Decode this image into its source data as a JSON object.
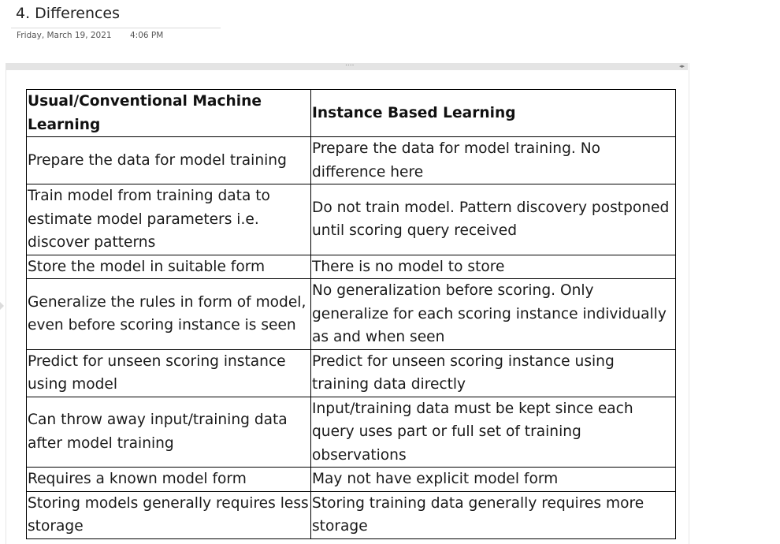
{
  "note": {
    "title": "4. Differences",
    "date": "Friday, March 19, 2021",
    "time": "4:06 PM"
  },
  "image_frame": {
    "grip": "....",
    "arrows": "◂▸"
  },
  "table": {
    "headers": [
      "Usual/Conventional Machine Learning",
      "Instance Based Learning"
    ],
    "rows": [
      [
        "Prepare the data for model training",
        "Prepare the data for model training. No difference here"
      ],
      [
        "Train model from training data to estimate model parameters i.e. discover patterns",
        "Do not train model. Pattern discovery postponed until scoring query received"
      ],
      [
        "Store the model in suitable form",
        "There is no model to store"
      ],
      [
        "Generalize the rules in form of model, even before scoring instance is seen",
        "No generalization before scoring. Only generalize for each scoring instance individually as and when seen"
      ],
      [
        "Predict for unseen scoring instance using model",
        "Predict for unseen scoring instance using training data directly"
      ],
      [
        "Can throw away input/training data after model training",
        "Input/training data must be kept since each query uses part or full set of training observations"
      ],
      [
        "Requires a known model form",
        "May not have explicit model form"
      ],
      [
        "Storing models generally requires less storage",
        "Storing training data generally requires more storage"
      ]
    ]
  }
}
